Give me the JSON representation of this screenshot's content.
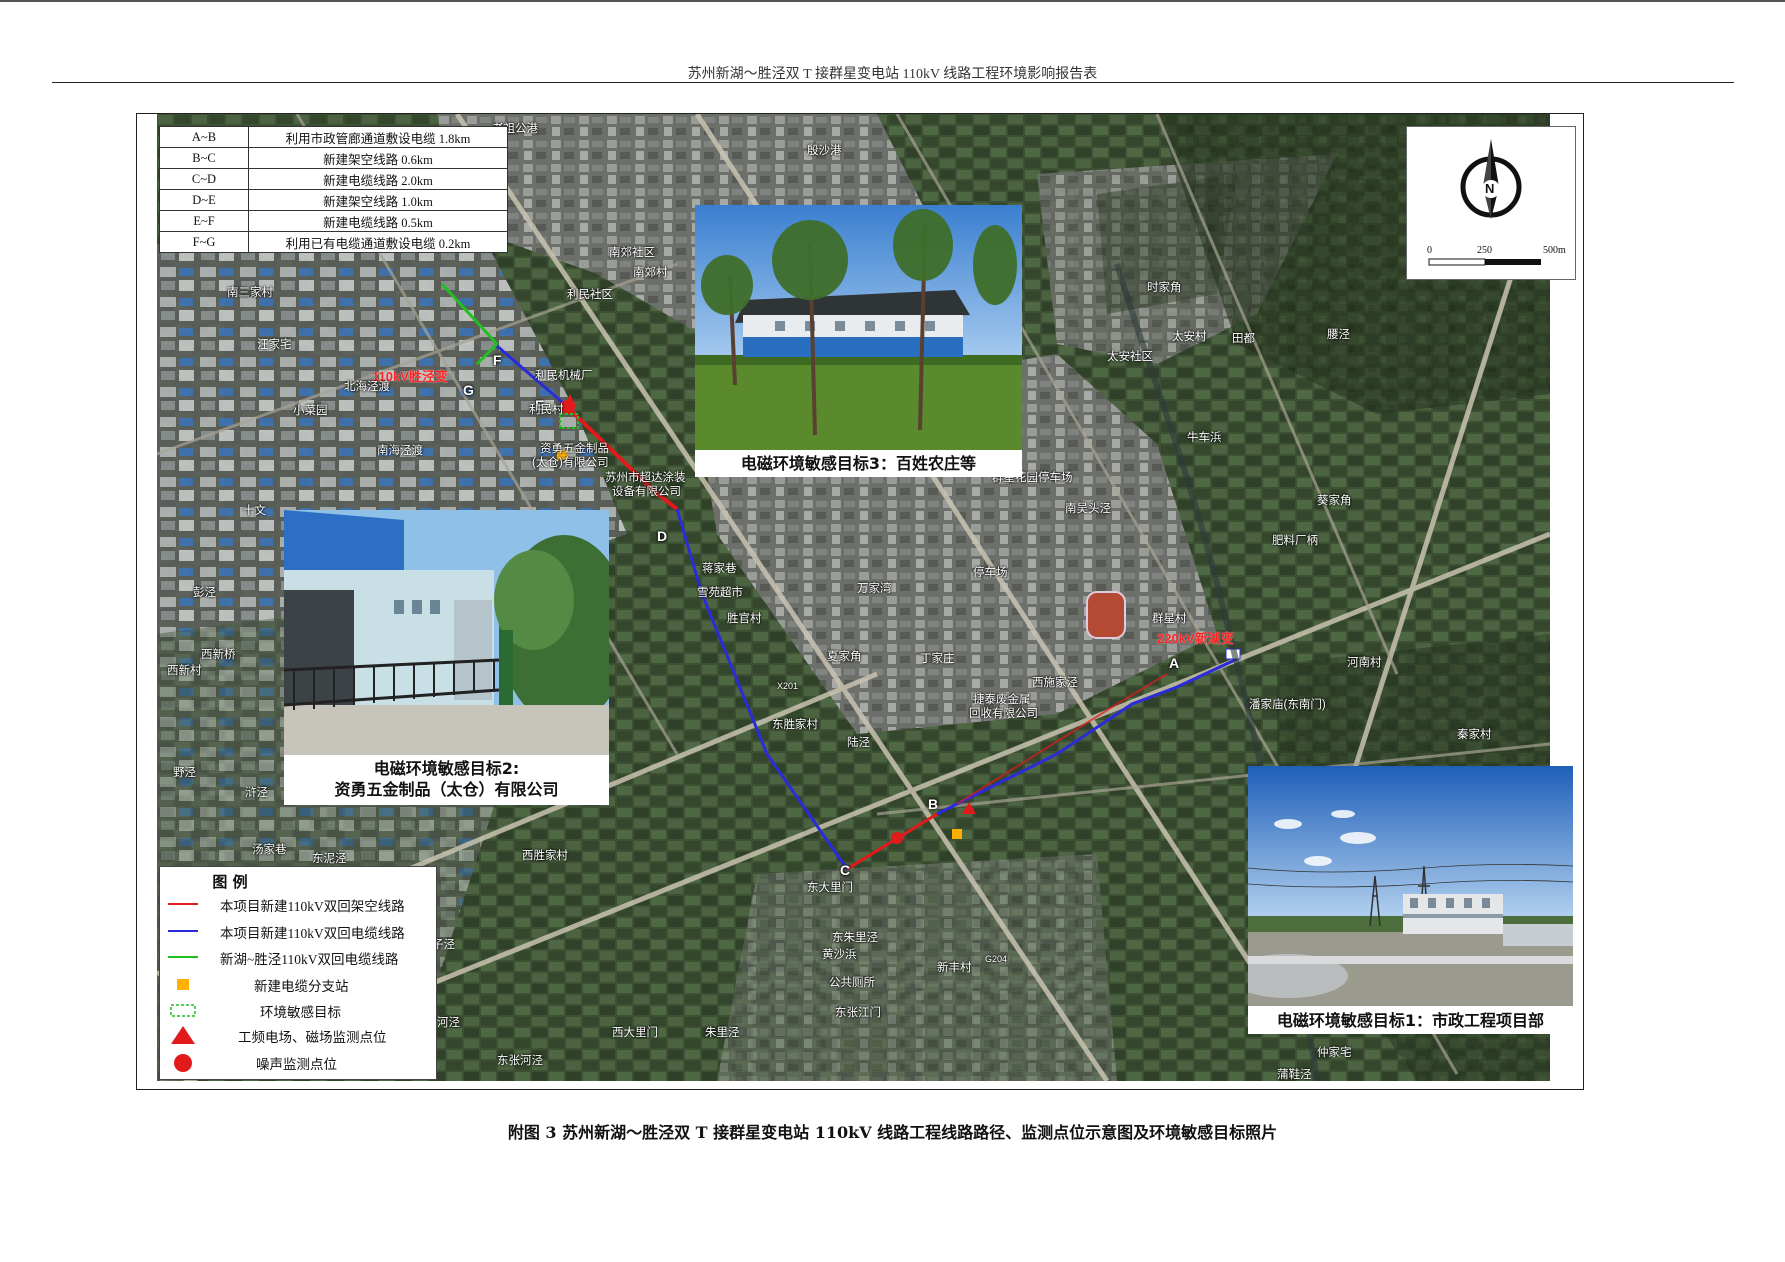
{
  "header": {
    "title": "苏州新湖～胜泾双 T 接群星变电站 110kV 线路工程环境影响报告表"
  },
  "segments": [
    {
      "code": "A~B",
      "desc": "利用市政管廊通道敷设电缆 1.8km"
    },
    {
      "code": "B~C",
      "desc": "新建架空线路 0.6km"
    },
    {
      "code": "C~D",
      "desc": "新建电缆线路 2.0km"
    },
    {
      "code": "D~E",
      "desc": "新建架空线路 1.0km"
    },
    {
      "code": "E~F",
      "desc": "新建电缆线路 0.5km"
    },
    {
      "code": "F~G",
      "desc": "利用已有电缆通道敷设电缆 0.2km"
    }
  ],
  "compass": {
    "north": "N",
    "scale": [
      "0",
      "250",
      "500m"
    ]
  },
  "points": {
    "A": "A",
    "B": "B",
    "C": "C",
    "D": "D",
    "E": "E",
    "F": "F",
    "G": "G"
  },
  "map_labels": {
    "substation_110": "110kV胜泾变",
    "substation_220": "220kV新湖变",
    "places": [
      "老祖公港",
      "殷沙港",
      "南郊社区",
      "南郊村",
      "利民社区",
      "南三家村",
      "利民机械厂",
      "北海泾渡",
      "小菜园",
      "利民村",
      "南海泾渡",
      "资勇五金制品",
      "(太仓)有限公司",
      "苏州市超达涂装",
      "设备有限公司",
      "蒋家巷",
      "雪苑超市",
      "胜官村",
      "夏家角",
      "丁家庄",
      "万家湾",
      "停车场",
      "群星花园停车场",
      "南吴头泾",
      "群星村",
      "西施家泾",
      "捷泰废金属",
      "回收有限公司",
      "潘家庙(东南门)",
      "河南村",
      "秦家村",
      "肥料厂柄",
      "葵家角",
      "牛车浜",
      "太安村",
      "田都",
      "太安社区",
      "时家角",
      "腰泾",
      "东胜家村",
      "陆泾",
      "东大里门",
      "东朱里泾",
      "黄沙浜",
      "公共厕所",
      "新丰村",
      "东张江门",
      "西大里门",
      "朱里泾",
      "东张河泾",
      "西胜家村",
      "东泥泾",
      "汤家巷",
      "浒泾",
      "野泾",
      "西新桥",
      "西新村",
      "彭泾",
      "汪家宅",
      "十文",
      "X201",
      "G204",
      "仲家宅",
      "蒲鞋泾",
      "子泾",
      "河泾"
    ]
  },
  "photos": [
    {
      "caption": "电磁环境敏感目标3：百姓农庄等"
    },
    {
      "caption_line1": "电磁环境敏感目标2:",
      "caption_line2": "资勇五金制品（太仓）有限公司"
    },
    {
      "caption": "电磁环境敏感目标1：市政工程项目部"
    }
  ],
  "legend": {
    "title": "图 例",
    "items": [
      {
        "label": "本项目新建110kV双回架空线路",
        "symbol": "red-line",
        "color": "#e31a1c"
      },
      {
        "label": "本项目新建110kV双回电缆线路",
        "symbol": "blue-line",
        "color": "#2b2bd9"
      },
      {
        "label": "新湖~胜泾110kV双回电缆线路",
        "symbol": "green-line",
        "color": "#21c021"
      },
      {
        "label": "新建电缆分支站",
        "symbol": "orange-square",
        "color": "#ffb000"
      },
      {
        "label": "环境敏感目标",
        "symbol": "green-dashed-box",
        "color": "#21c021"
      },
      {
        "label": "工频电场、磁场监测点位",
        "symbol": "red-triangle",
        "color": "#e31a1c"
      },
      {
        "label": "噪声监测点位",
        "symbol": "red-circle",
        "color": "#e31a1c"
      }
    ]
  },
  "figure_caption": "附图 3  苏州新湖～胜泾双 T 接群星变电站 110kV 线路工程线路路径、监测点位示意图及环境敏感目标照片"
}
